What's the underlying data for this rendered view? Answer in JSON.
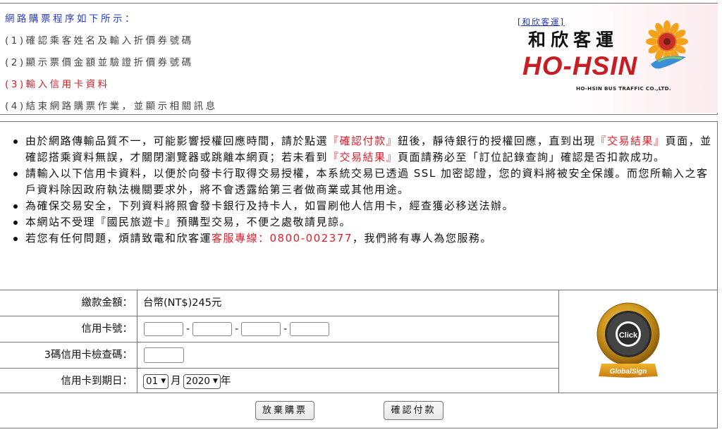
{
  "steps": {
    "title": "網路購票程序如下所示：",
    "items": [
      "(1)確認乘客姓名及輸入折價券號碼",
      "(2)顯示票價金額並驗證折價券號碼",
      "(3)輸入信用卡資料",
      "(4)結束網路購票作業，並顯示相關訊息"
    ]
  },
  "logo": {
    "link_text": "[和欣客運]",
    "cn_name": "和欣客運",
    "en_name": "HO-HSIN",
    "sub_name": "HO-HSIN BUS TRAFFIC CO.,LTD."
  },
  "notice": {
    "n1a": "由於網路傳輸品質不一，可能影響授權回應時間，請於點選",
    "n1b": "『確認付款』",
    "n1c": "鈕後，靜待銀行的授權回應，直到出現",
    "n1d": "『交易結果』",
    "n1e": "頁面，並確認搭乘資料無誤，才關閉瀏覽器或跳離本網頁；若未看到",
    "n1f": "『交易結果』",
    "n1g": "頁面請務必至「訂位記錄查詢」確認是否扣款成功。",
    "n2": "請輸入以下信用卡資料，以便於向發卡行取得交易授權，本系統交易已透過 SSL 加密認證，您的資料將被安全保護。而您所輸入之客戶資料除因政府執法機關要求外，將不會透露給第三者做商業或其他用途。",
    "n3": "為確保交易安全，下列資料將照會發卡銀行及持卡人，如冒刷他人信用卡，經查獲必移送法辦。",
    "n4": "本網站不受理『國民旅遊卡』預購型交易，不便之處敬請見諒。",
    "n5a": "若您有任何問題，煩請致電和欣客運",
    "n5b": "客服專線：0800-002377",
    "n5c": "，我們將有專人為您服務。"
  },
  "form": {
    "amount_label": "繳款金額：",
    "amount_value": "台幣(NT$)245元",
    "card_label": "信用卡號：",
    "card_sep": "-",
    "cvv_label": "3碼信用卡檢查碼：",
    "expiry_label": "信用卡到期日：",
    "month_value": "01",
    "month_unit": "月",
    "year_value": "2020",
    "year_unit": "年"
  },
  "seal": {
    "ring_text": "AUTHENTICATED",
    "center": "Click",
    "brand": "GlobalSign"
  },
  "buttons": {
    "cancel": "放棄購票",
    "confirm": "確認付款"
  },
  "colors": {
    "title_blue": "#2a3cc8",
    "highlight_red": "#e11d2a",
    "brand_red": "#c81d22"
  }
}
